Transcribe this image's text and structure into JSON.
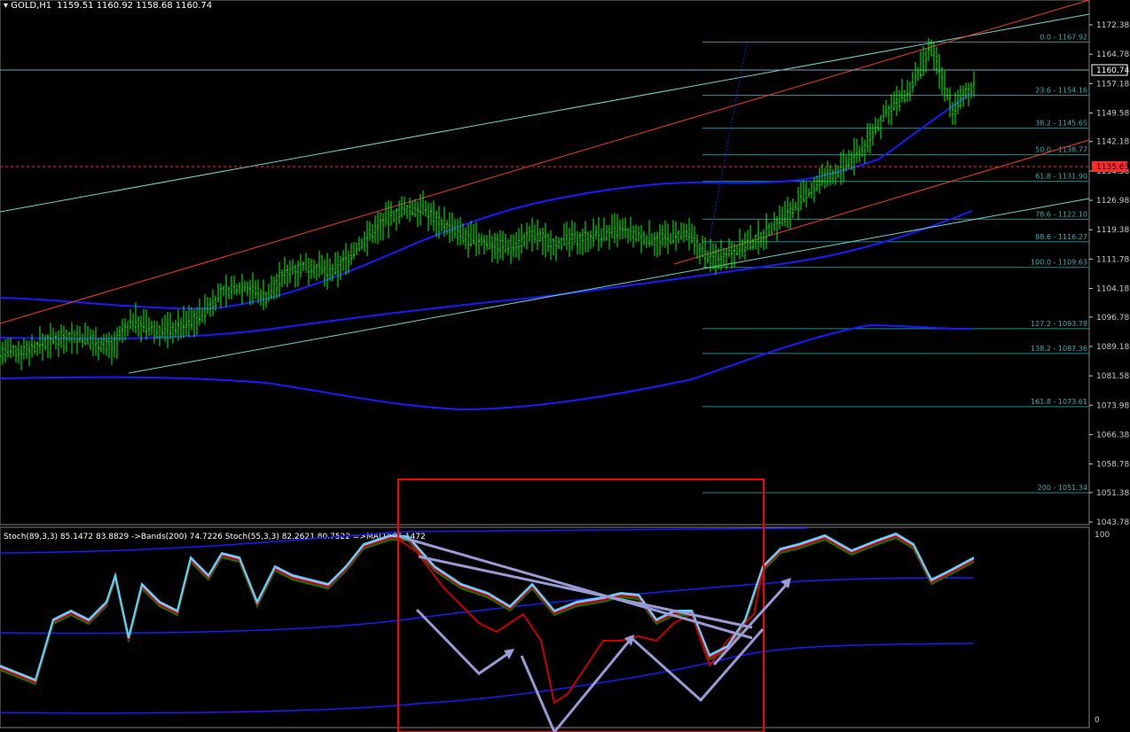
{
  "header": {
    "symbol": "GOLD,H1",
    "ohlc": "1159.51 1160.92 1158.68 1160.74",
    "indicator_line": "Stoch(89,3,3) 85.1472 83.8829 ->Bands(200) 74.7226 Stoch(55,3,3) 82.2621 80.7522 =>MA(1) 85.1472"
  },
  "price_axis": {
    "ticks": [
      "1172.38",
      "1164.78",
      "1157.18",
      "1149.58",
      "1142.18",
      "1134.58",
      "1126.98",
      "1119.38",
      "1111.78",
      "1104.18",
      "1096.78",
      "1089.18",
      "1081.58",
      "1073.98",
      "1066.38",
      "1058.78",
      "1051.38",
      "1043.78"
    ],
    "current_price": "1160.74",
    "marked_price": "1135.63"
  },
  "osc_axis": {
    "top": "100",
    "bottom": "0"
  },
  "colors": {
    "background": "#000000",
    "grid": "#000000",
    "candle": "#00ff00",
    "ma": "#1a1aff",
    "red_line": "#ff3b1f",
    "teal_line": "#6fd6c8",
    "fib": "#1e8c8c",
    "highlight_box": "#ff0000",
    "arrows": "#9a9ad6",
    "stoch_cyan": "#40e0ff",
    "stoch_red": "#cc0000",
    "stoch_green": "#008000"
  },
  "fibonacci": [
    {
      "label": "0.0 - 1167.92",
      "level": 1167.92
    },
    {
      "label": "23.6 - 1154.16",
      "level": 1154.16
    },
    {
      "label": "38.2 - 1145.65",
      "level": 1145.65
    },
    {
      "label": "50.0 - 1138.77",
      "level": 1138.77
    },
    {
      "label": "61.8 - 1131.90",
      "level": 1131.9
    },
    {
      "label": "78.6 - 1122.10",
      "level": 1122.1
    },
    {
      "label": "88.6 - 1116.27",
      "level": 1116.27
    },
    {
      "label": "100.0 - 1109.63",
      "level": 1109.63
    },
    {
      "label": "127.2 - 1093.78",
      "level": 1093.78
    },
    {
      "label": "138.2 - 1087.36",
      "level": 1087.36
    },
    {
      "label": "161.8 - 1073.61",
      "level": 1073.61
    },
    {
      "label": "200 - 1051.34",
      "level": 1051.34
    }
  ],
  "chart_data": {
    "type": "line",
    "title": "GOLD,H1",
    "ylim": [
      1043.78,
      1172.38
    ],
    "x": [
      0,
      25,
      50,
      75,
      100,
      125,
      150,
      175,
      200,
      225,
      250,
      275,
      300,
      325,
      350,
      375,
      400,
      425,
      450,
      475,
      500,
      525,
      550,
      575,
      600,
      625,
      650,
      675,
      700,
      725,
      750,
      775,
      800,
      825,
      850,
      875,
      900,
      925,
      950,
      975,
      1000,
      1025,
      1050,
      1075,
      1100
    ],
    "series": [
      {
        "values": [
          1087.5,
          1088,
          1090,
          1092,
          1091,
          1089,
          1096,
          1093,
          1094,
          1097,
          1103,
          1105,
          1102,
          1109,
          1110,
          1108,
          1114,
          1120,
          1124,
          1125,
          1121,
          1117,
          1116,
          1115,
          1118,
          1116,
          1117,
          1118,
          1119,
          1117,
          1117,
          1118,
          1112,
          1114,
          1116,
          1121,
          1126,
          1132,
          1135,
          1141,
          1150,
          1155,
          1166,
          1150,
          1158
        ]
      }
    ]
  }
}
